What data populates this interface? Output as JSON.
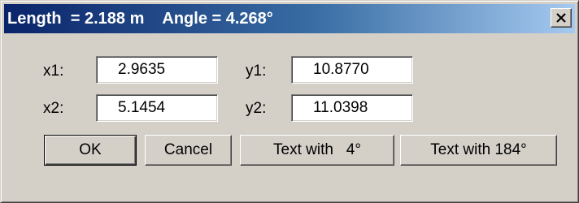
{
  "window": {
    "title_length": "Length  = 2.188 m",
    "title_angle": "Angle = 4.268°"
  },
  "fields": {
    "x1": {
      "label": "x1:",
      "value": "2.9635"
    },
    "y1": {
      "label": "y1:",
      "value": "10.8770"
    },
    "x2": {
      "label": "x2:",
      "value": "5.1454"
    },
    "y2": {
      "label": "y2:",
      "value": "11.0398"
    }
  },
  "buttons": {
    "ok": "OK",
    "cancel": "Cancel",
    "text_with_4": "Text with   4°",
    "text_with_184": "Text with 184°"
  },
  "icons": {
    "close": "close-icon"
  }
}
